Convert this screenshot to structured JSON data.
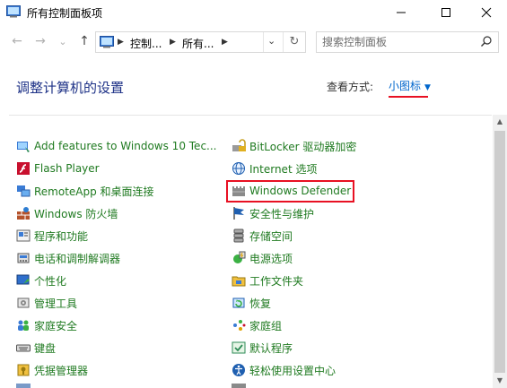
{
  "window": {
    "title": "所有控制面板项",
    "minimize_glyph": "—",
    "maximize_glyph": "☐",
    "close_glyph": "✕"
  },
  "nav": {
    "back_glyph": "←",
    "forward_glyph": "→",
    "recent_glyph": "⌄",
    "up_glyph": "↑",
    "breadcrumbs": [
      "控制...",
      "所有..."
    ],
    "refresh_glyph": "↻",
    "search_placeholder": "搜索控制面板"
  },
  "header": {
    "title": "调整计算机的设置",
    "view_by_label": "查看方式:",
    "view_by_value": "小图标",
    "accent_color": "#e81123"
  },
  "items_left": [
    {
      "label": "Add features to Windows 10 Tec...",
      "icon": "add-features-icon"
    },
    {
      "label": "Flash Player",
      "icon": "flash-icon"
    },
    {
      "label": "RemoteApp 和桌面连接",
      "icon": "remoteapp-icon"
    },
    {
      "label": "Windows 防火墙",
      "icon": "firewall-icon"
    },
    {
      "label": "程序和功能",
      "icon": "programs-icon"
    },
    {
      "label": "电话和调制解调器",
      "icon": "phone-modem-icon"
    },
    {
      "label": "个性化",
      "icon": "personalization-icon"
    },
    {
      "label": "管理工具",
      "icon": "admin-tools-icon"
    },
    {
      "label": "家庭安全",
      "icon": "family-safety-icon"
    },
    {
      "label": "键盘",
      "icon": "keyboard-icon"
    },
    {
      "label": "凭据管理器",
      "icon": "credential-icon"
    }
  ],
  "items_right": [
    {
      "label": "BitLocker 驱动器加密",
      "icon": "bitlocker-icon"
    },
    {
      "label": "Internet 选项",
      "icon": "internet-options-icon"
    },
    {
      "label": "Windows Defender",
      "icon": "defender-icon"
    },
    {
      "label": "安全性与维护",
      "icon": "security-flag-icon"
    },
    {
      "label": "存储空间",
      "icon": "storage-icon"
    },
    {
      "label": "电源选项",
      "icon": "power-icon"
    },
    {
      "label": "工作文件夹",
      "icon": "work-folders-icon"
    },
    {
      "label": "恢复",
      "icon": "recovery-icon"
    },
    {
      "label": "家庭组",
      "icon": "homegroup-icon"
    },
    {
      "label": "默认程序",
      "icon": "default-programs-icon"
    },
    {
      "label": "轻松使用设置中心",
      "icon": "ease-of-access-icon"
    }
  ],
  "colors": {
    "link_green": "#1f7a20",
    "heading_blue": "#1e3287",
    "view_blue": "#0066cc",
    "highlight_red": "#e81123"
  }
}
